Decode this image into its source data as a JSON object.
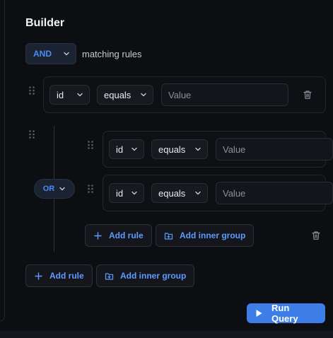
{
  "builder": {
    "title": "Builder",
    "combinator": "AND",
    "combinator_suffix": "matching rules",
    "rules": [
      {
        "field": "id",
        "operator": "equals",
        "value_placeholder": "Value"
      }
    ],
    "inner_group": {
      "combinator": "OR",
      "rules": [
        {
          "field": "id",
          "operator": "equals",
          "value_placeholder": "Value"
        },
        {
          "field": "id",
          "operator": "equals",
          "value_placeholder": "Value"
        }
      ],
      "add_rule_label": "Add rule",
      "add_group_label": "Add inner group"
    },
    "add_rule_label": "Add rule",
    "add_group_label": "Add inner group",
    "run_label": "Run Query"
  },
  "colors": {
    "accent": "#4b8bf5",
    "run_button": "#3d7fe6",
    "background": "#0d0e12"
  },
  "icons": [
    "chevron-down-icon",
    "drag-handle-icon",
    "trash-icon",
    "plus-icon",
    "folder-plus-icon",
    "play-icon"
  ]
}
